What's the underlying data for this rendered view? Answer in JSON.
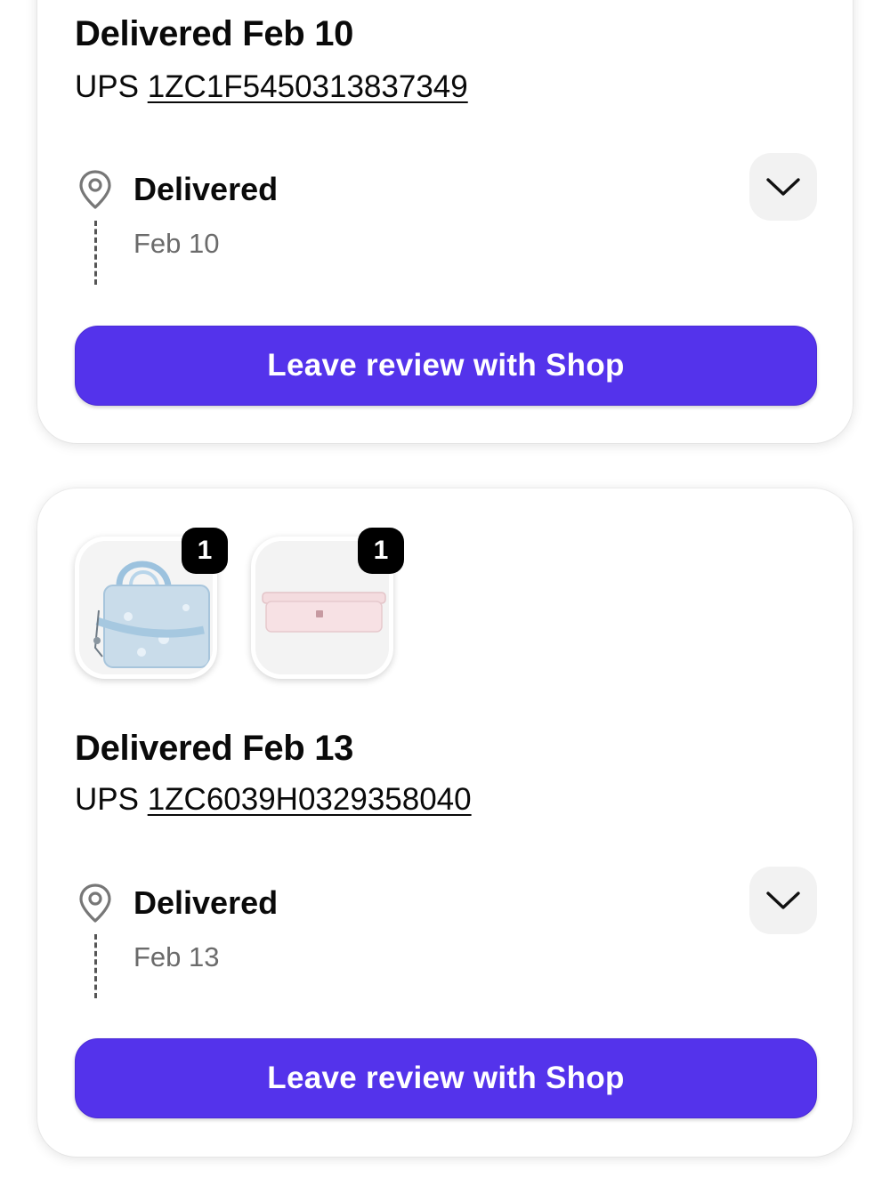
{
  "shipments": [
    {
      "title": "Delivered Feb 10",
      "carrier": "UPS",
      "tracking_number": "1ZC1F5450313837349",
      "status": "Delivered",
      "status_date": "Feb 10",
      "review_label": "Leave review with Shop"
    },
    {
      "items": [
        {
          "quantity": "1",
          "image_icon": "tote-bag-product-image"
        },
        {
          "quantity": "1",
          "image_icon": "pink-storage-container-product-image"
        }
      ],
      "title": "Delivered Feb 13",
      "carrier": "UPS",
      "tracking_number": "1ZC6039H0329358040",
      "status": "Delivered",
      "status_date": "Feb 13",
      "review_label": "Leave review with Shop"
    }
  ],
  "colors": {
    "primary_button": "#5433eb",
    "badge_background": "#000000",
    "muted_text": "#6b6b6b",
    "chevron_button_bg": "#f2f2f2"
  }
}
